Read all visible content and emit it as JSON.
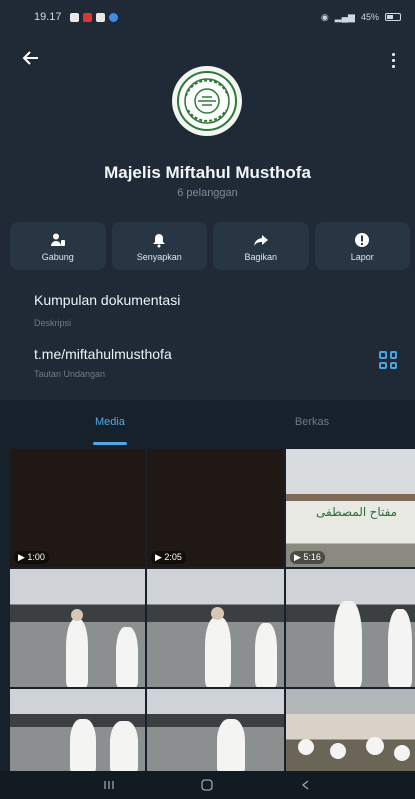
{
  "status_bar": {
    "time": "19.17",
    "signal_text": "45%"
  },
  "channel": {
    "name": "Majelis Miftahul Musthofa",
    "subscribers": "6 pelanggan"
  },
  "actions": [
    {
      "label": "Gabung",
      "icon": "join-icon"
    },
    {
      "label": "Senyapkan",
      "icon": "bell-icon"
    },
    {
      "label": "Bagikan",
      "icon": "share-icon"
    },
    {
      "label": "Lapor",
      "icon": "alert-icon"
    }
  ],
  "info": {
    "description": "Kumpulan dokumentasi",
    "description_label": "Deskripsi",
    "link": "t.me/miftahulmusthofa",
    "link_label": "Tautan Undangan"
  },
  "tabs": {
    "media": "Media",
    "files": "Berkas"
  },
  "media": [
    {
      "type": "video",
      "duration": "1:00"
    },
    {
      "type": "video",
      "duration": "2:05"
    },
    {
      "type": "video",
      "duration": "5:16"
    },
    {
      "type": "photo"
    },
    {
      "type": "photo"
    },
    {
      "type": "photo"
    },
    {
      "type": "photo"
    },
    {
      "type": "photo"
    },
    {
      "type": "photo"
    }
  ],
  "colors": {
    "accent": "#4fa8e8",
    "header_bg": "#1f2a36",
    "background": "#17212b"
  }
}
